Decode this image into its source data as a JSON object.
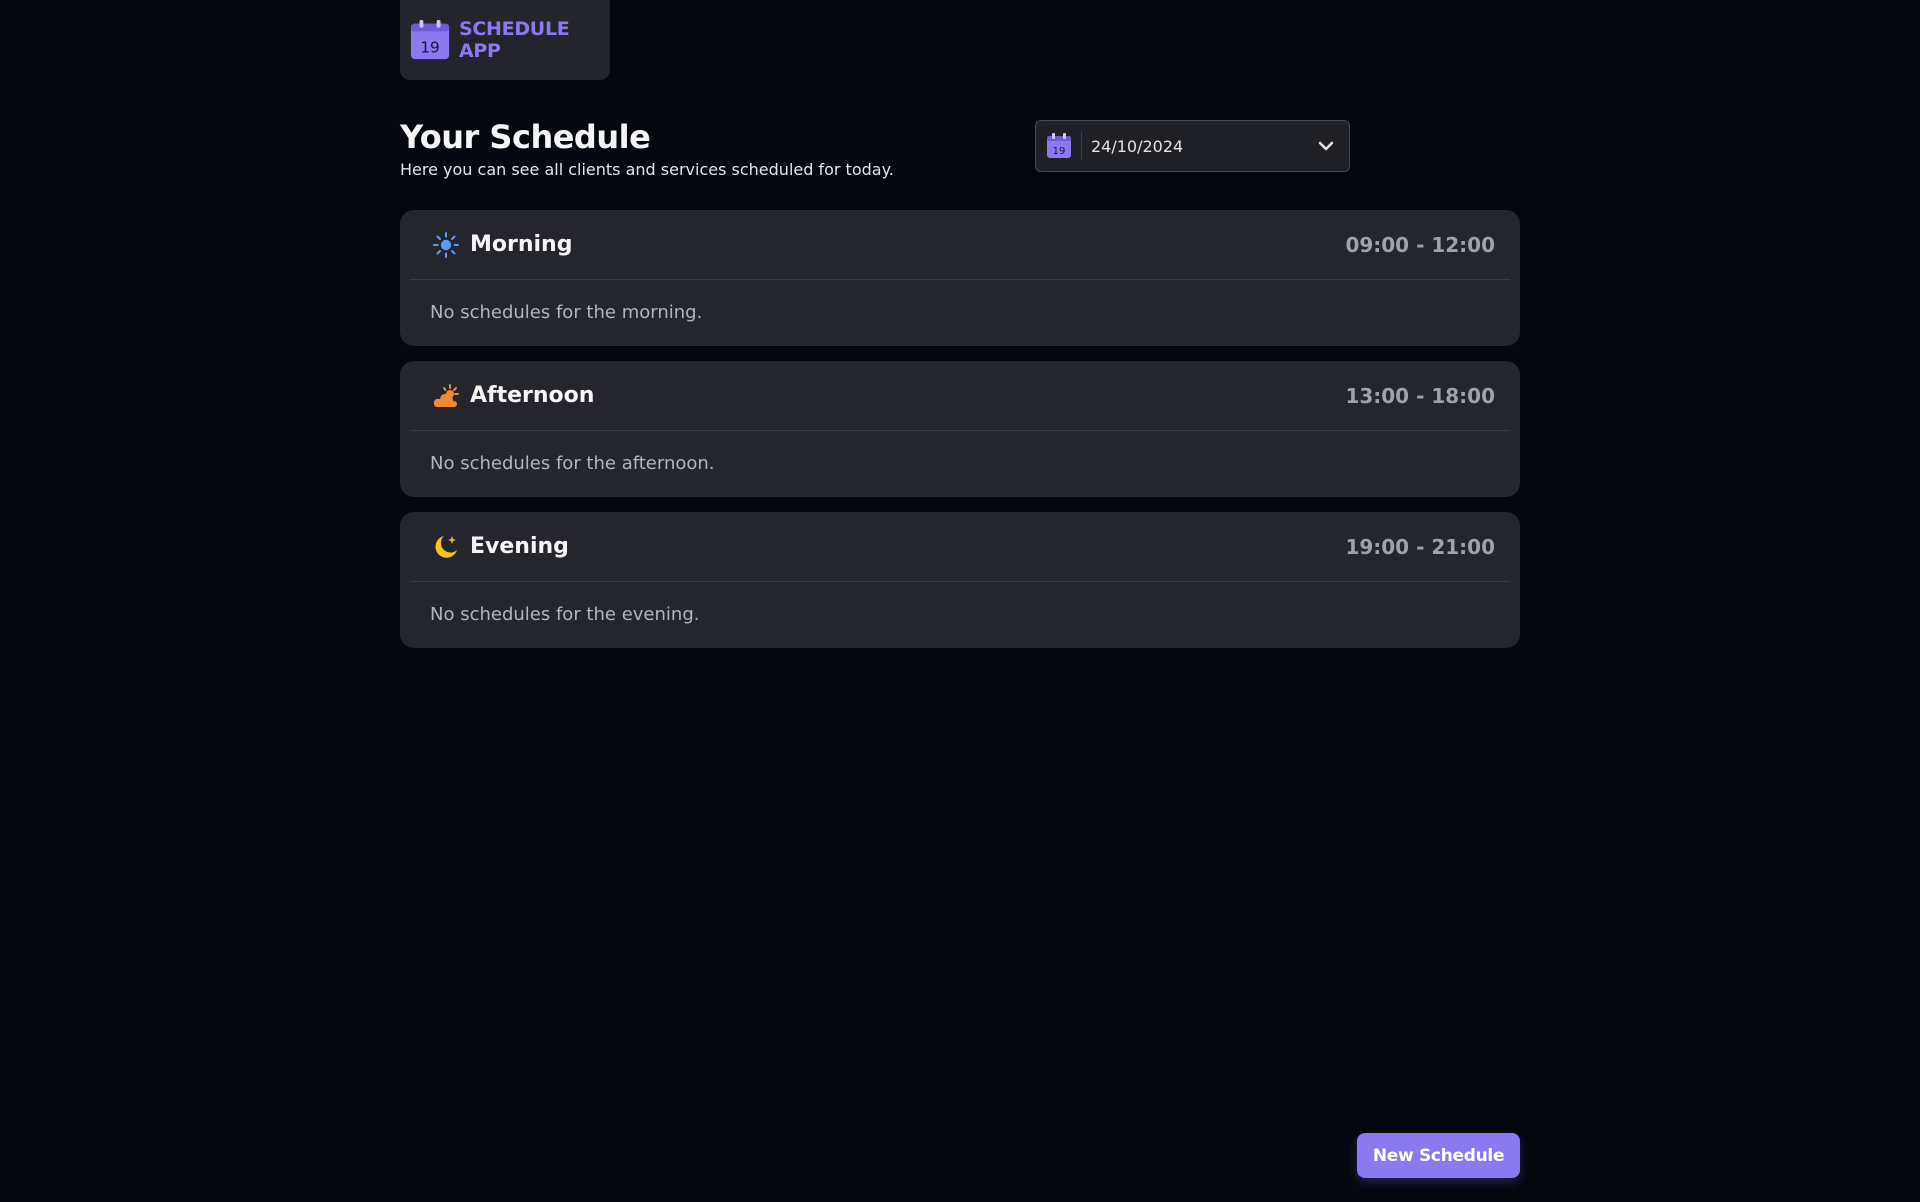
{
  "app": {
    "logo_day": "19",
    "name": "SCHEDULE APP"
  },
  "header": {
    "title": "Your Schedule",
    "subtitle": "Here you can see all clients and services scheduled for today."
  },
  "date_picker": {
    "icon_day": "19",
    "value": "24/10/2024",
    "icon": "calendar-icon",
    "dropdown_icon": "chevron-down-icon"
  },
  "periods": [
    {
      "title": "Morning",
      "time": "09:00 - 12:00",
      "empty_text": "No schedules for the morning.",
      "icon": "sun-icon",
      "icon_color": "#5b9cf5"
    },
    {
      "title": "Afternoon",
      "time": "13:00 - 18:00",
      "empty_text": "No schedules for the afternoon.",
      "icon": "cloud-sun-icon",
      "icon_color": "#f08a34"
    },
    {
      "title": "Evening",
      "time": "19:00 - 21:00",
      "empty_text": "No schedules for the evening.",
      "icon": "moon-stars-icon",
      "icon_color": "#f5c518"
    }
  ],
  "actions": {
    "new_schedule_label": "New Schedule"
  },
  "colors": {
    "accent": "#8b79f0",
    "background": "#05070f",
    "card": "#25252d"
  }
}
